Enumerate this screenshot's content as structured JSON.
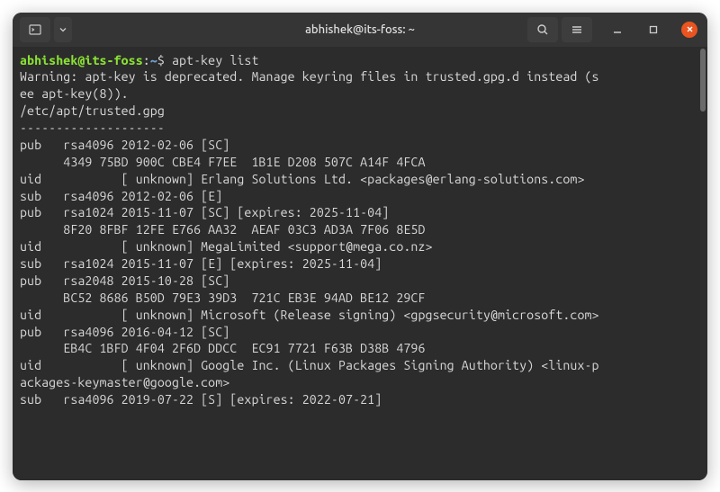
{
  "titlebar": {
    "title": "abhishek@its-foss: ~"
  },
  "prompt": {
    "user_host": "abhishek@its-foss",
    "colon": ":",
    "path": "~",
    "dollar": "$ ",
    "command": "apt-key list"
  },
  "lines": [
    "Warning: apt-key is deprecated. Manage keyring files in trusted.gpg.d instead (s",
    "ee apt-key(8)).",
    "/etc/apt/trusted.gpg",
    "--------------------",
    "pub   rsa4096 2012-02-06 [SC]",
    "      4349 75BD 900C CBE4 F7EE  1B1E D208 507C A14F 4FCA",
    "uid           [ unknown] Erlang Solutions Ltd. <packages@erlang-solutions.com>",
    "sub   rsa4096 2012-02-06 [E]",
    "",
    "pub   rsa1024 2015-11-07 [SC] [expires: 2025-11-04]",
    "      8F20 8FBF 12FE E766 AA32  AEAF 03C3 AD3A 7F06 8E5D",
    "uid           [ unknown] MegaLimited <support@mega.co.nz>",
    "sub   rsa1024 2015-11-07 [E] [expires: 2025-11-04]",
    "",
    "pub   rsa2048 2015-10-28 [SC]",
    "      BC52 8686 B50D 79E3 39D3  721C EB3E 94AD BE12 29CF",
    "uid           [ unknown] Microsoft (Release signing) <gpgsecurity@microsoft.com>",
    "",
    "pub   rsa4096 2016-04-12 [SC]",
    "      EB4C 1BFD 4F04 2F6D DDCC  EC91 7721 F63B D38B 4796",
    "uid           [ unknown] Google Inc. (Linux Packages Signing Authority) <linux-p",
    "ackages-keymaster@google.com>",
    "sub   rsa4096 2019-07-22 [S] [expires: 2022-07-21]"
  ]
}
